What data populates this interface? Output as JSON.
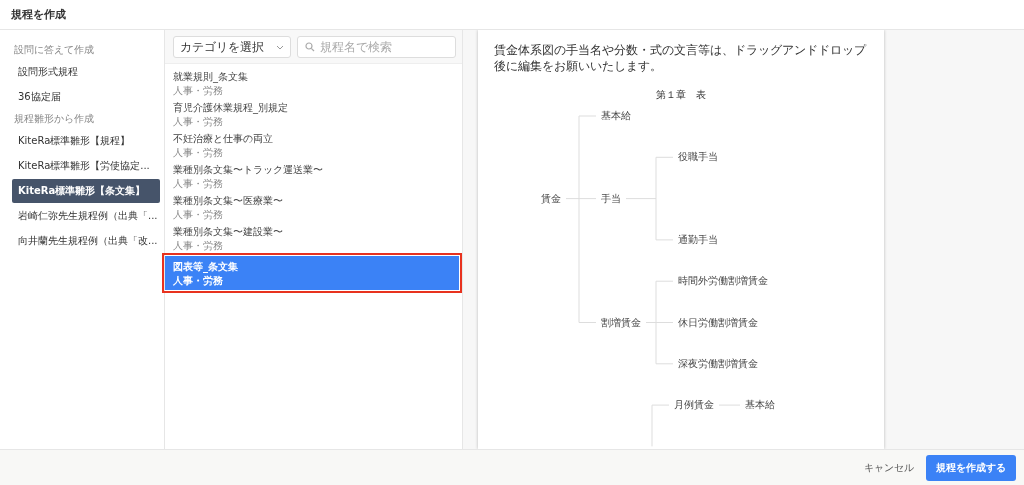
{
  "window": {
    "title": "規程を作成"
  },
  "sidebar": {
    "sections": [
      {
        "label": "設問に答えて作成",
        "items": [
          {
            "label": "設問形式規程",
            "selected": false
          },
          {
            "label": "36協定届",
            "selected": false
          }
        ]
      },
      {
        "label": "規程雛形から作成",
        "items": [
          {
            "label": "KiteRa標準雛形【規程】",
            "selected": false
          },
          {
            "label": "KiteRa標準雛形【労使協定...",
            "selected": false
          },
          {
            "label": "KiteRa標準雛形【条文集】",
            "selected": true
          },
          {
            "label": "岩崎仁弥先生規程例（出典「...",
            "selected": false
          },
          {
            "label": "向井蘭先生規程例（出典「改...",
            "selected": false
          }
        ]
      }
    ]
  },
  "filters": {
    "category": "カテゴリを選択",
    "search": {
      "placeholder": "規程名で検索"
    }
  },
  "templates": [
    {
      "name": "就業規則_条文集",
      "category": "人事・労務",
      "selected": false
    },
    {
      "name": "育児介護休業規程_別規定",
      "category": "人事・労務",
      "selected": false
    },
    {
      "name": "不妊治療と仕事の両立",
      "category": "人事・労務",
      "selected": false
    },
    {
      "name": "業種別条文集〜トラック運送業〜",
      "category": "人事・労務",
      "selected": false
    },
    {
      "name": "業種別条文集〜医療業〜",
      "category": "人事・労務",
      "selected": false
    },
    {
      "name": "業種別条文集〜建設業〜",
      "category": "人事・労務",
      "selected": false
    },
    {
      "name": "図表等_条文集",
      "category": "人事・労務",
      "selected": true
    }
  ],
  "preview": {
    "note": "賃金体系図の手当名や分数・式の文言等は、ドラッグアンドドロップ後に編集をお願いいたします。",
    "heading": "第１章　表",
    "trees": [
      {
        "label": "賃金",
        "children": [
          {
            "label": "基本給"
          },
          {
            "label": "手当",
            "children": [
              {
                "label": "役職手当"
              },
              {
                "label": "通勤手当"
              }
            ]
          },
          {
            "label": "割増賃金",
            "children": [
              {
                "label": "時間外労働割増賃金"
              },
              {
                "label": "休日労働割増賃金"
              },
              {
                "label": "深夜労働割増賃金"
              }
            ]
          }
        ]
      },
      {
        "children": [
          {
            "label": "月例賃金",
            "children": [
              {
                "label": "基本給"
              }
            ]
          }
        ]
      }
    ]
  },
  "footer": {
    "cancel": "キャンセル",
    "submit": "規程を作成する"
  }
}
